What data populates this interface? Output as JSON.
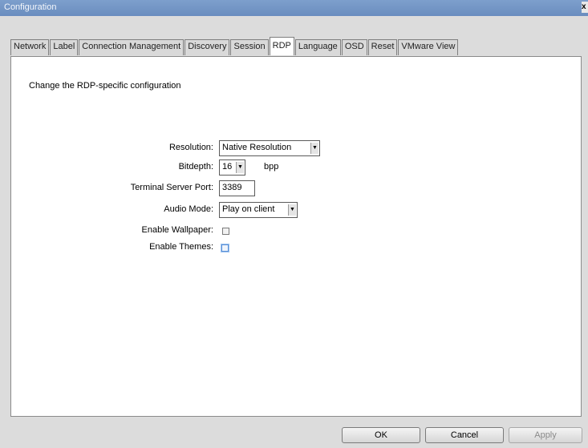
{
  "window": {
    "title": "Configuration",
    "close_label": "x"
  },
  "tabs": [
    {
      "label": "Network"
    },
    {
      "label": "Label"
    },
    {
      "label": "Connection Management"
    },
    {
      "label": "Discovery"
    },
    {
      "label": "Session"
    },
    {
      "label": "RDP",
      "active": true
    },
    {
      "label": "Language"
    },
    {
      "label": "OSD"
    },
    {
      "label": "Reset"
    },
    {
      "label": "VMware View"
    }
  ],
  "panel": {
    "heading": "Change the RDP-specific configuration",
    "resolution": {
      "label": "Resolution:",
      "value": "Native Resolution"
    },
    "bitdepth": {
      "label": "Bitdepth:",
      "value": "16",
      "unit": "bpp"
    },
    "port": {
      "label": "Terminal Server Port:",
      "value": "3389"
    },
    "audio": {
      "label": "Audio Mode:",
      "value": "Play on client"
    },
    "wallpaper": {
      "label": "Enable Wallpaper:",
      "checked": false
    },
    "themes": {
      "label": "Enable Themes:",
      "checked": false
    }
  },
  "buttons": {
    "ok": "OK",
    "cancel": "Cancel",
    "apply": "Apply"
  }
}
